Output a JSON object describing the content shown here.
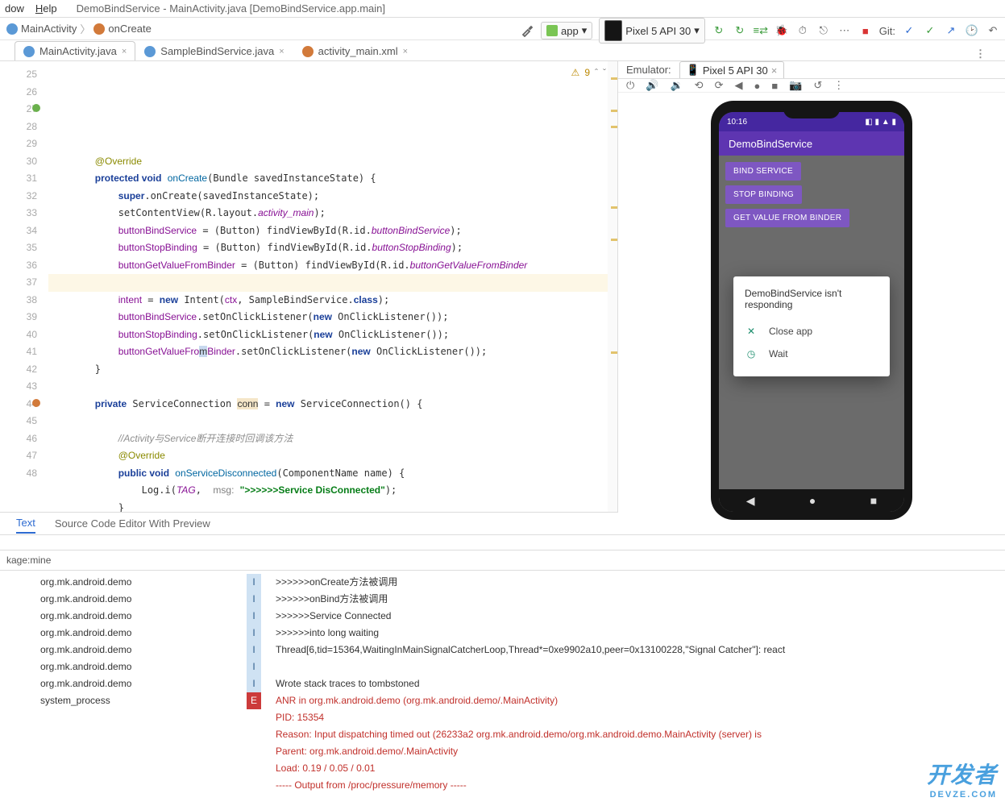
{
  "menu": {
    "item1": "dow",
    "item2": "Help",
    "title": "DemoBindService - MainActivity.java [DemoBindService.app.main]"
  },
  "breadcrumb": {
    "c1": "MainActivity",
    "c2": "onCreate"
  },
  "toolbar": {
    "app_label": "app",
    "device_label": "Pixel 5 API 30",
    "git_label": "Git:"
  },
  "tabs": {
    "t1": "MainActivity.java",
    "t2": "SampleBindService.java",
    "t3": "activity_main.xml"
  },
  "warn_count": "9",
  "code": {
    "lines": [
      25,
      26,
      27,
      28,
      29,
      30,
      31,
      32,
      33,
      34,
      35,
      36,
      37,
      38,
      39,
      40,
      41,
      42,
      43,
      44,
      45,
      46,
      47,
      48
    ]
  },
  "emulator": {
    "header": "Emulator:",
    "tab": "Pixel 5 API 30"
  },
  "phone": {
    "time": "10:16",
    "app_title": "DemoBindService",
    "btn1": "BIND SERVICE",
    "btn2": "STOP BINDING",
    "btn3": "GET VALUE FROM BINDER",
    "dialog_title": "DemoBindService isn't responding",
    "dialog_close": "Close app",
    "dialog_wait": "Wait"
  },
  "footer": {
    "tab1": "Text",
    "tab2": "Source Code Editor With Preview"
  },
  "filter": "kage:mine",
  "log": {
    "rows": [
      {
        "pkg": "org.mk.android.demo",
        "lvl": "I",
        "msg": ">>>>>>onCreate方法被调用"
      },
      {
        "pkg": "org.mk.android.demo",
        "lvl": "I",
        "msg": ">>>>>>onBind方法被调用"
      },
      {
        "pkg": "org.mk.android.demo",
        "lvl": "I",
        "msg": ">>>>>>Service Connected"
      },
      {
        "pkg": "org.mk.android.demo",
        "lvl": "I",
        "msg": ">>>>>>into long waiting"
      },
      {
        "pkg": "org.mk.android.demo",
        "lvl": "I",
        "msg": "Thread[6,tid=15364,WaitingInMainSignalCatcherLoop,Thread*=0xe9902a10,peer=0x13100228,\"Signal Catcher\"]: react"
      },
      {
        "pkg": "org.mk.android.demo",
        "lvl": "I",
        "msg": ""
      },
      {
        "pkg": "org.mk.android.demo",
        "lvl": "I",
        "msg": "Wrote stack traces to tombstoned"
      },
      {
        "pkg": "system_process",
        "lvl": "E",
        "err": true,
        "msg": "ANR in org.mk.android.demo (org.mk.android.demo/.MainActivity)"
      },
      {
        "pkg": "",
        "lvl": "",
        "err": true,
        "msg": "PID: 15354"
      },
      {
        "pkg": "",
        "lvl": "",
        "err": true,
        "msg": "Reason: Input dispatching timed out (26233a2 org.mk.android.demo/org.mk.android.demo.MainActivity (server) is"
      },
      {
        "pkg": "",
        "lvl": "",
        "err": true,
        "msg": "Parent: org.mk.android.demo/.MainActivity"
      },
      {
        "pkg": "",
        "lvl": "",
        "err": true,
        "msg": "Load: 0.19 / 0.05 / 0.01"
      },
      {
        "pkg": "",
        "lvl": "",
        "err": true,
        "msg": "----- Output from /proc/pressure/memory -----"
      }
    ]
  },
  "watermark": {
    "main": "开发者",
    "sub": "DEVZE.COM"
  }
}
